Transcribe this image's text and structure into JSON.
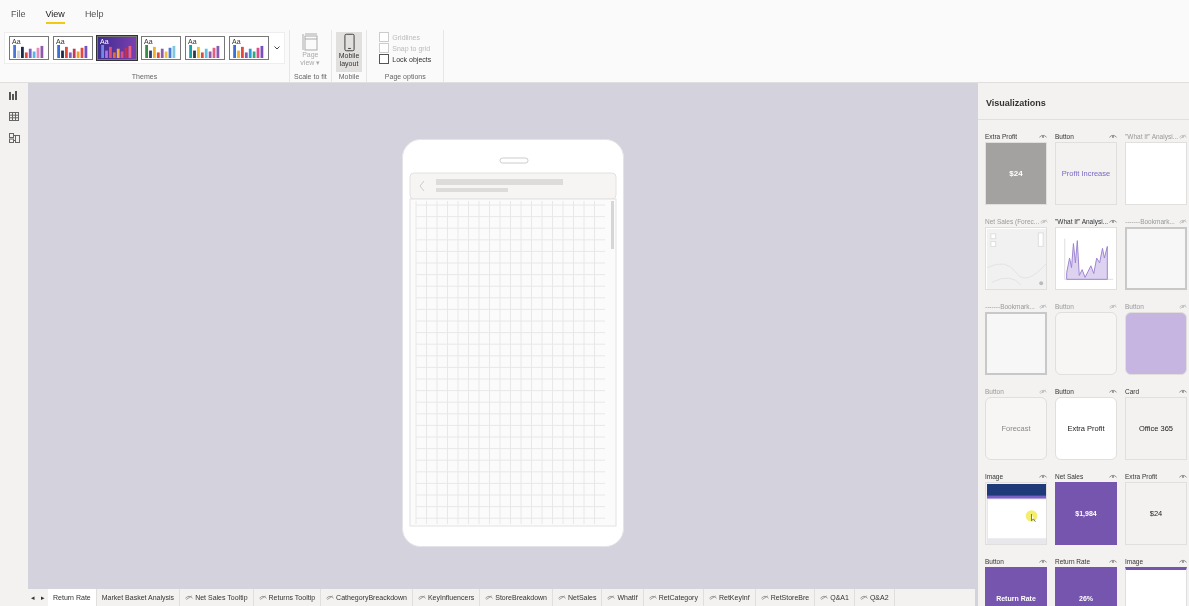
{
  "menu": [
    {
      "label": "File",
      "selected": false
    },
    {
      "label": "View",
      "selected": true
    },
    {
      "label": "Help",
      "selected": false
    }
  ],
  "ribbon": {
    "themes": [
      {
        "label": "Aa",
        "selected": false,
        "dark": false
      },
      {
        "label": "Aa",
        "selected": false,
        "dark": false
      },
      {
        "label": "Aa",
        "selected": true,
        "dark": true
      },
      {
        "label": "Aa",
        "selected": false,
        "dark": false
      },
      {
        "label": "Aa",
        "selected": false,
        "dark": false
      },
      {
        "label": "Aa",
        "selected": false,
        "dark": false
      }
    ],
    "themes_group": "Themes",
    "page_view": {
      "label": "Page",
      "sublabel": "view ▾",
      "disabled": true
    },
    "scale_group": "Scale to fit",
    "mobile_layout": {
      "label": "Mobile",
      "sublabel": "layout",
      "selected": true
    },
    "mobile_group": "Mobile",
    "page_options": [
      {
        "label": "Gridlines",
        "checked": false,
        "disabled": true
      },
      {
        "label": "Snap to grid",
        "checked": false,
        "disabled": true
      },
      {
        "label": "Lock objects",
        "checked": false,
        "disabled": false
      }
    ],
    "page_options_group": "Page options"
  },
  "visualizations": {
    "title": "Visualizations",
    "tiles": [
      {
        "title": "Extra Profit",
        "hidden": false,
        "kind": "card-inverse",
        "text": "$24"
      },
      {
        "title": "Button",
        "hidden": false,
        "kind": "link",
        "text": "Profit Increase"
      },
      {
        "title": "\"What If\" Analysi...",
        "hidden": true,
        "kind": "blank"
      },
      {
        "title": "Net Sales (Forec...",
        "hidden": true,
        "kind": "map"
      },
      {
        "title": "\"What If\" Analysi...",
        "hidden": false,
        "kind": "chart"
      },
      {
        "title": "-------Bookmark...",
        "hidden": true,
        "kind": "outlined"
      },
      {
        "title": "-------Bookmark...",
        "hidden": true,
        "kind": "outlined"
      },
      {
        "title": "Button",
        "hidden": true,
        "kind": "rounded"
      },
      {
        "title": "Button",
        "hidden": true,
        "kind": "lilac"
      },
      {
        "title": "Button",
        "hidden": true,
        "kind": "rounded",
        "text": "Forecast"
      },
      {
        "title": "Button",
        "hidden": false,
        "kind": "rounded-white",
        "text": "Extra Profit"
      },
      {
        "title": "Card",
        "hidden": false,
        "kind": "card",
        "text": "Office 365"
      },
      {
        "title": "Image",
        "hidden": false
      },
      {
        "title": "Net Sales",
        "hidden": false,
        "kind": "purple",
        "text": "$1,984"
      },
      {
        "title": "Extra Profit",
        "hidden": false,
        "kind": "card",
        "text": "$24"
      },
      {
        "title": "Button",
        "hidden": false,
        "kind": "purple",
        "text": "Return Rate"
      },
      {
        "title": "Return Rate",
        "hidden": false,
        "kind": "purple",
        "text": "26%"
      },
      {
        "title": "Image",
        "hidden": false,
        "kind": "image-top"
      }
    ]
  },
  "page_nav": [
    "◂",
    "▸"
  ],
  "pages": [
    {
      "label": "Return Rate",
      "selected": true,
      "hidden": false
    },
    {
      "label": "Market Basket Analysis",
      "selected": false,
      "hidden": false
    },
    {
      "label": "Net Sales Tooltip",
      "selected": false,
      "hidden": true
    },
    {
      "label": "Returns Tooltip",
      "selected": false,
      "hidden": true
    },
    {
      "label": "CathegoryBreackdown",
      "selected": false,
      "hidden": true
    },
    {
      "label": "KeyInfluencers",
      "selected": false,
      "hidden": true
    },
    {
      "label": "StoreBreakdown",
      "selected": false,
      "hidden": true
    },
    {
      "label": "NetSales",
      "selected": false,
      "hidden": true
    },
    {
      "label": "WhatIf",
      "selected": false,
      "hidden": true
    },
    {
      "label": "RetCategory",
      "selected": false,
      "hidden": true
    },
    {
      "label": "RetKeyInf",
      "selected": false,
      "hidden": true
    },
    {
      "label": "RetStoreBre",
      "selected": false,
      "hidden": true
    },
    {
      "label": "Q&A1",
      "selected": false,
      "hidden": true
    },
    {
      "label": "Q&A2",
      "selected": false,
      "hidden": true
    }
  ]
}
